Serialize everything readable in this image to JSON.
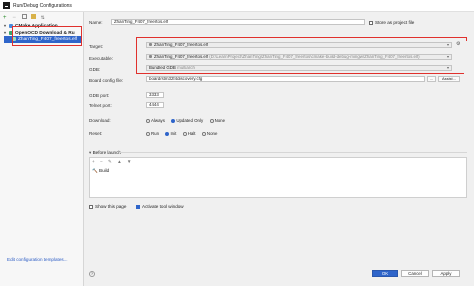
{
  "window": {
    "title": "Run/Debug Configurations"
  },
  "left_panel": {
    "toolbar_icons": [
      "add-icon",
      "remove-icon",
      "copy-icon",
      "folder-icon",
      "sort-icon"
    ],
    "tree": [
      {
        "label": "CMake Application",
        "level": 0
      },
      {
        "label": "OpenOCD Download & Ru",
        "level": 0
      },
      {
        "label": "ZhanTing_F407_freertos.elf",
        "level": 1
      }
    ],
    "edit_templates_link": "Edit configuration templates..."
  },
  "form": {
    "name_label": "Name:",
    "name_value": "ZhanTing_F407_freertos.elf",
    "store_label": "Store as project file",
    "target_label": "Target:",
    "target_value": "ZhanTing_F407_freertos.elf",
    "executable_label": "Executable:",
    "executable_value": "ZhanTing_F407_freertos.elf",
    "executable_path": "(D:\\LearnProject\\ZhanTing\\ZhanTing_F407_freertos\\cmake-build-debug-mingw\\ZhanTing_F407_freertos.elf)",
    "gdb_label": "GDB:",
    "gdb_value": "Bundled GDB",
    "gdb_hint": "multiarch",
    "board_label": "Board config file:",
    "board_value": "board/stm32f4discovery.cfg",
    "assist_label": "Assist...",
    "dots_label": "...",
    "gdb_port_label": "GDB port:",
    "gdb_port_value": "3333",
    "telnet_port_label": "Telnet port:",
    "telnet_port_value": "4444",
    "download_label": "Download:",
    "download_options": [
      "Always",
      "Updated Only",
      "None"
    ],
    "download_selected": "Updated Only",
    "reset_label": "Reset:",
    "reset_options": [
      "Run",
      "Init",
      "Halt",
      "None"
    ],
    "reset_selected": "Init"
  },
  "before_launch": {
    "header": "Before launch",
    "toolbar": [
      "+",
      "−",
      "✎",
      "▲",
      "▼"
    ],
    "items": [
      "Build"
    ]
  },
  "options": {
    "show_page_label": "Show this page",
    "activate_tool_label": "Activate tool window"
  },
  "buttons": {
    "ok": "OK",
    "cancel": "Cancel",
    "apply": "Apply"
  },
  "colors": {
    "accent": "#2f65ca",
    "highlight_border": "#e0312d"
  }
}
